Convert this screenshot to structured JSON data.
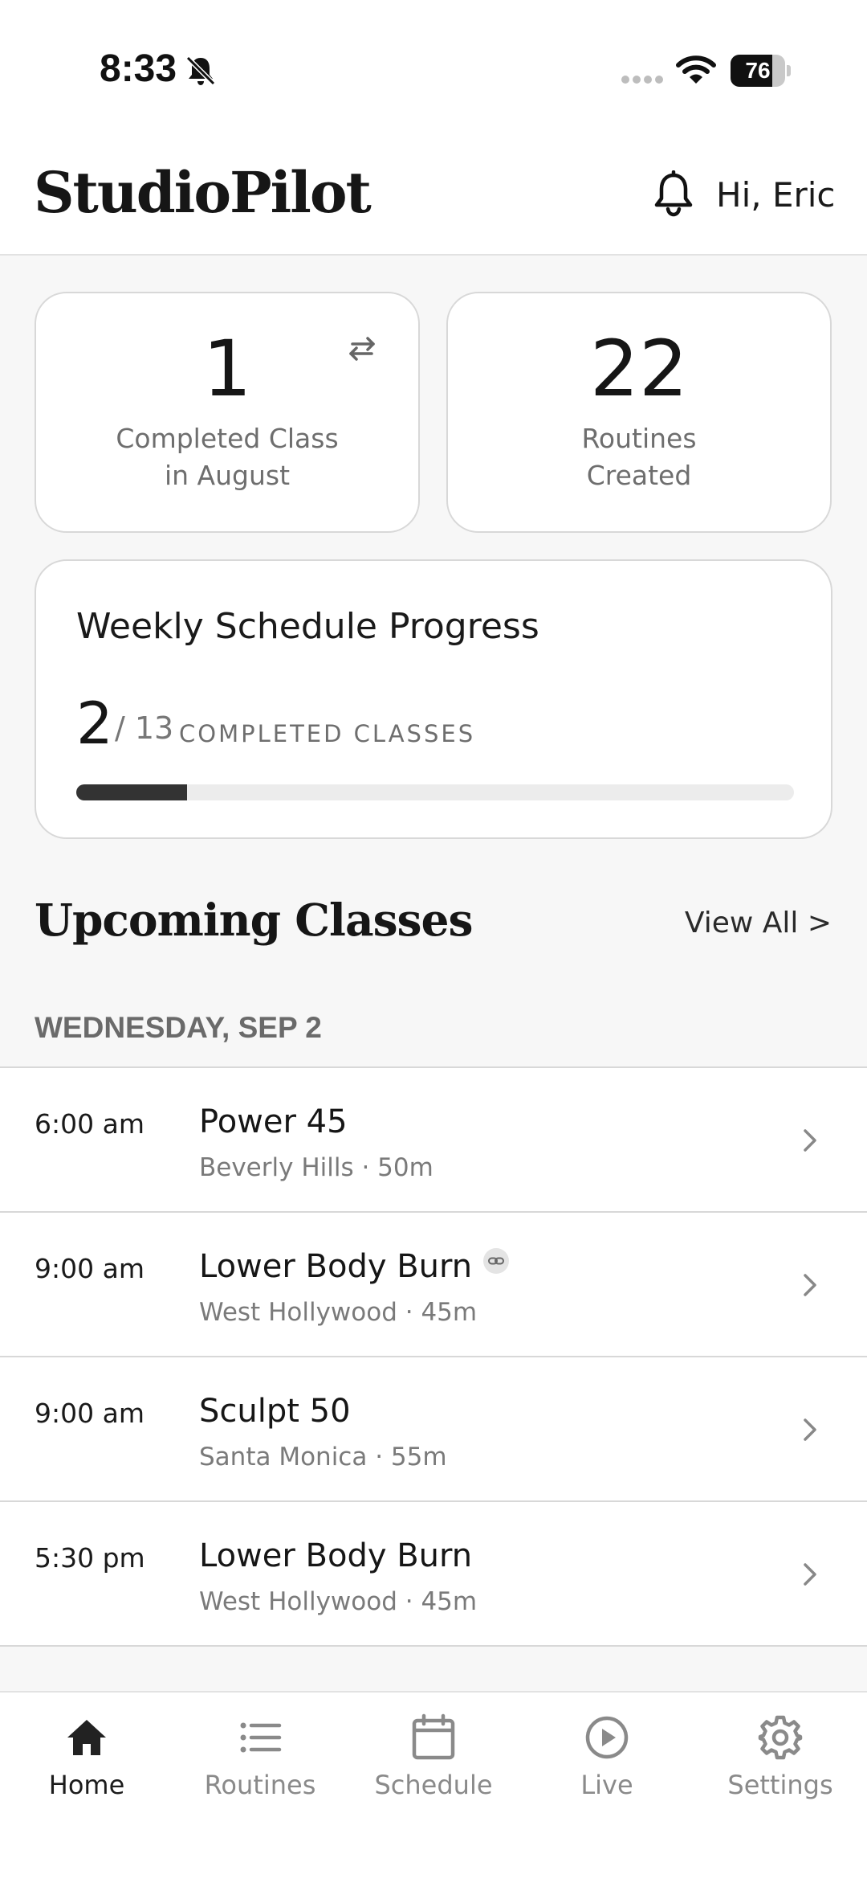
{
  "status_bar": {
    "time": "8:33",
    "battery_level": 76,
    "battery_text": "76",
    "icons": [
      "bell-off-icon",
      "signal-dots-icon",
      "wifi-icon",
      "battery-icon"
    ]
  },
  "header": {
    "brand": "StudioPilot",
    "greeting": "Hi, Eric",
    "icon": "bell-icon"
  },
  "stats": {
    "completed": {
      "value": "1",
      "label_line1": "Completed Class",
      "label_line2": "in August",
      "icon": "swap-icon"
    },
    "routines": {
      "value": "22",
      "label_line1": "Routines",
      "label_line2": "Created"
    }
  },
  "progress": {
    "title": "Weekly Schedule Progress",
    "completed": "2",
    "total": "/ 13",
    "caption": "COMPLETED CLASSES",
    "completed_count": 2,
    "total_count": 13
  },
  "upcoming": {
    "title": "Upcoming Classes",
    "view_all": "View All >",
    "day": "WEDNESDAY, SEP 2",
    "classes": [
      {
        "time": "6:00 am",
        "name": "Power 45",
        "meta": "Beverly Hills · 50m",
        "linked": false
      },
      {
        "time": "9:00 am",
        "name": "Lower Body Burn",
        "meta": "West Hollywood · 45m",
        "linked": true
      },
      {
        "time": "9:00 am",
        "name": "Sculpt 50",
        "meta": "Santa Monica · 55m",
        "linked": false
      },
      {
        "time": "5:30 pm",
        "name": "Lower Body Burn",
        "meta": "West Hollywood · 45m",
        "linked": false
      }
    ]
  },
  "nav": {
    "items": [
      {
        "label": "Home",
        "icon": "home-icon",
        "active": true
      },
      {
        "label": "Routines",
        "icon": "list-icon",
        "active": false
      },
      {
        "label": "Schedule",
        "icon": "calendar-icon",
        "active": false
      },
      {
        "label": "Live",
        "icon": "play-circle-icon",
        "active": false
      },
      {
        "label": "Settings",
        "icon": "gear-icon",
        "active": false
      }
    ]
  },
  "colors": {
    "background": "#f7f7f7",
    "card": "#ffffff",
    "accent": "#333333",
    "muted_text": "#7a7a7a"
  }
}
